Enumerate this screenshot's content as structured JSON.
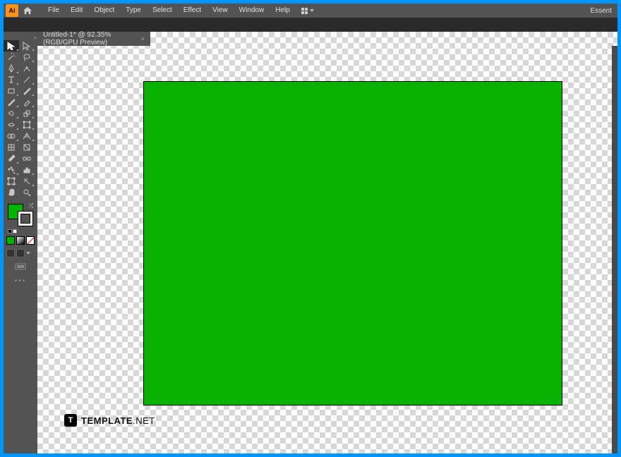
{
  "app": {
    "logo_text": "Ai",
    "brand_right": "Essent"
  },
  "menu": {
    "file": "File",
    "edit": "Edit",
    "object": "Object",
    "type": "Type",
    "select": "Select",
    "effect": "Effect",
    "view": "View",
    "window": "Window",
    "help": "Help"
  },
  "tab": {
    "label": "Untitled-1* @ 92.35% (RGB/GPU Preview)",
    "close": "×"
  },
  "canvas": {
    "zoom_percent": 92.35,
    "color_mode": "RGB",
    "preview_mode": "GPU Preview",
    "rectangle_fill": "#09b200",
    "rectangle_stroke": "#000000",
    "fill_color": "#00b400",
    "stroke_color": "#ffffff"
  },
  "tools": {
    "selection": "selection",
    "direct": "direct-selection",
    "wand": "magic-wand",
    "lasso": "lasso",
    "pen": "pen",
    "curvature": "curvature",
    "type": "type",
    "line": "line-segment",
    "rect": "rectangle",
    "brush": "paintbrush",
    "pencil": "shaper",
    "eraser": "eraser",
    "rotate": "rotate",
    "scale": "reflect",
    "width": "width",
    "warp": "free-transform",
    "shape": "shape-builder",
    "perspective": "perspective-grid",
    "mesh": "mesh",
    "gradient": "gradient",
    "eyedrop": "eyedropper",
    "blend": "blend",
    "symbol": "symbol-sprayer",
    "graph": "column-graph",
    "artboard": "artboard",
    "slice": "slice",
    "hand": "hand",
    "zoom": "zoom"
  },
  "watermark": {
    "icon": "T",
    "brand": "TEMPLATE",
    "suffix": ".NET"
  }
}
